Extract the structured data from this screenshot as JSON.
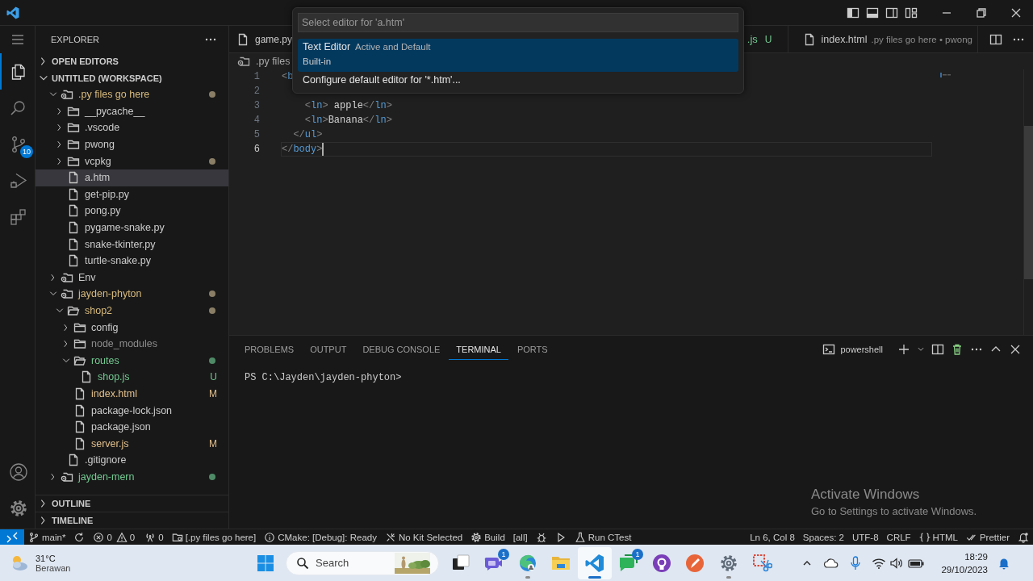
{
  "quick_pick": {
    "placeholder": "Select editor for 'a.htm'",
    "items": [
      {
        "label": "Text Editor",
        "description": "Active and Default",
        "detail": "Built-in",
        "selected": true
      },
      {
        "label": "Configure default editor for '*.htm'...",
        "selected": false
      }
    ]
  },
  "activity_bar": {
    "items": [
      {
        "kind": "explorer",
        "selected": true
      },
      {
        "kind": "search",
        "selected": false
      },
      {
        "kind": "source_control",
        "selected": false,
        "badge": "10"
      },
      {
        "kind": "run",
        "selected": false
      },
      {
        "kind": "extensions",
        "selected": false
      }
    ],
    "bottom": [
      {
        "kind": "account"
      },
      {
        "kind": "settings"
      }
    ]
  },
  "sidebar": {
    "title": "EXPLORER",
    "sections": [
      {
        "label": "OPEN EDITORS",
        "expanded": false
      },
      {
        "label": "UNTITLED (WORKSPACE)",
        "expanded": true,
        "tree": [
          {
            "label": ".py files go here",
            "kind": "root",
            "expanded": true,
            "selected": false,
            "color": "#d7ba7d",
            "status_dot": {
              "color": "#8a7e66"
            },
            "children": [
              {
                "label": "__pycache__",
                "kind": "folder",
                "expanded": false,
                "selected": false,
                "color": "#cccccc"
              },
              {
                "label": ".vscode",
                "kind": "folder",
                "expanded": false,
                "selected": false,
                "color": "#cccccc"
              },
              {
                "label": "pwong",
                "kind": "folder",
                "expanded": false,
                "selected": false,
                "color": "#cccccc"
              },
              {
                "label": "vcpkg",
                "kind": "folder",
                "expanded": false,
                "selected": false,
                "color": "#cccccc",
                "status_dot": {
                  "color": "#8a7e66"
                }
              },
              {
                "label": "a.htm",
                "kind": "file",
                "selected": true,
                "color": "#cccccc"
              },
              {
                "label": "get-pip.py",
                "kind": "file",
                "selected": false,
                "color": "#cccccc"
              },
              {
                "label": "pong.py",
                "kind": "file",
                "selected": false,
                "color": "#cccccc"
              },
              {
                "label": "pygame-snake.py",
                "kind": "file",
                "selected": false,
                "color": "#cccccc"
              },
              {
                "label": "snake-tkinter.py",
                "kind": "file",
                "selected": false,
                "color": "#cccccc"
              },
              {
                "label": "turtle-snake.py",
                "kind": "file",
                "selected": false,
                "color": "#cccccc"
              }
            ]
          },
          {
            "label": "Env",
            "kind": "root",
            "expanded": false,
            "selected": false,
            "color": "#cccccc"
          },
          {
            "label": "jayden-phyton",
            "kind": "root",
            "expanded": true,
            "selected": false,
            "color": "#d7ba7d",
            "status_dot": {
              "color": "#8a7e66"
            },
            "children": [
              {
                "label": "shop2",
                "kind": "folder",
                "expanded": true,
                "selected": false,
                "color": "#d7ba7d",
                "status_dot": {
                  "color": "#8a7e66"
                },
                "children": [
                  {
                    "label": "config",
                    "kind": "folder",
                    "expanded": false,
                    "selected": false,
                    "color": "#cccccc"
                  },
                  {
                    "label": "node_modules",
                    "kind": "folder",
                    "expanded": false,
                    "selected": false,
                    "color": "#8c8c8c"
                  },
                  {
                    "label": "routes",
                    "kind": "folder",
                    "expanded": true,
                    "selected": false,
                    "color": "#73c991",
                    "status_dot": {
                      "color": "#4e8a66"
                    },
                    "children": [
                      {
                        "label": "shop.js",
                        "kind": "file",
                        "selected": false,
                        "color": "#73c991",
                        "badge": "U"
                      }
                    ]
                  },
                  {
                    "label": "index.html",
                    "kind": "file",
                    "selected": false,
                    "color": "#e2c08d",
                    "badge": "M"
                  },
                  {
                    "label": "package-lock.json",
                    "kind": "file",
                    "selected": false,
                    "color": "#cccccc"
                  },
                  {
                    "label": "package.json",
                    "kind": "file",
                    "selected": false,
                    "color": "#cccccc"
                  },
                  {
                    "label": "server.js",
                    "kind": "file",
                    "selected": false,
                    "color": "#e2c08d",
                    "badge": "M"
                  }
                ]
              },
              {
                "label": ".gitignore",
                "kind": "file",
                "selected": false,
                "color": "#cccccc"
              }
            ]
          },
          {
            "label": "jayden-mern",
            "kind": "root",
            "expanded": false,
            "selected": false,
            "color": "#73c991",
            "status_dot": {
              "color": "#4e8a66"
            }
          }
        ]
      }
    ],
    "bottom_sections": [
      {
        "label": "OUTLINE",
        "expanded": false
      },
      {
        "label": "TIMELINE",
        "expanded": false
      }
    ]
  },
  "editor": {
    "tabs": [
      {
        "label": "game.py",
        "color": "#cccccc"
      },
      {
        "label": ".js",
        "color": "#73c991",
        "badge": "U"
      },
      {
        "label": "index.html",
        "color": "#c5c5c5",
        "description": ".py files go here • pwong"
      }
    ],
    "breadcrumb": ".py files",
    "lines": [
      {
        "number": "1",
        "selected": false,
        "tokens": [
          {
            "kind": "punct",
            "text": "<"
          },
          {
            "kind": "tag",
            "text": "b"
          }
        ]
      },
      {
        "number": "2",
        "selected": false
      },
      {
        "number": "3",
        "selected": false,
        "tokens": [
          {
            "kind": "punct",
            "text": "    <"
          },
          {
            "kind": "tag",
            "text": "ln"
          },
          {
            "kind": "punct",
            "text": ">"
          },
          {
            "kind": "text",
            "text": " apple"
          },
          {
            "kind": "punct",
            "text": "</"
          },
          {
            "kind": "tag",
            "text": "ln"
          },
          {
            "kind": "punct",
            "text": ">"
          }
        ]
      },
      {
        "number": "4",
        "selected": false,
        "tokens": [
          {
            "kind": "punct",
            "text": "    <"
          },
          {
            "kind": "tag",
            "text": "ln"
          },
          {
            "kind": "punct",
            "text": ">"
          },
          {
            "kind": "text",
            "text": "Banana"
          },
          {
            "kind": "punct",
            "text": "</"
          },
          {
            "kind": "tag",
            "text": "ln"
          },
          {
            "kind": "punct",
            "text": ">"
          }
        ]
      },
      {
        "number": "5",
        "selected": false,
        "tokens": [
          {
            "kind": "punct",
            "text": "  </"
          },
          {
            "kind": "tag",
            "text": "ul"
          },
          {
            "kind": "punct",
            "text": ">"
          }
        ]
      },
      {
        "number": "6",
        "selected": true,
        "tokens": [
          {
            "kind": "punct",
            "text": "</"
          },
          {
            "kind": "tag",
            "text": "body"
          },
          {
            "kind": "punct",
            "text": ">"
          }
        ]
      }
    ]
  },
  "panel": {
    "tabs": [
      {
        "label": "PROBLEMS",
        "selected": false
      },
      {
        "label": "OUTPUT",
        "selected": false
      },
      {
        "label": "DEBUG CONSOLE",
        "selected": false
      },
      {
        "label": "TERMINAL",
        "selected": true
      },
      {
        "label": "PORTS",
        "selected": false
      }
    ],
    "terminal_name": "powershell",
    "terminal_lines": [
      "PS C:\\Jayden\\jayden-phyton>"
    ]
  },
  "activation_notice": {
    "title": "Activate Windows",
    "subtitle": "Go to Settings to activate Windows."
  },
  "status_bar": {
    "left": [
      {
        "kind": "remote"
      },
      {
        "kind": "branch",
        "text": "main*"
      },
      {
        "kind": "sync"
      },
      {
        "kind": "errors",
        "text": "0"
      },
      {
        "kind": "warnings",
        "text": "0"
      },
      {
        "kind": "ports",
        "text": "0"
      },
      {
        "kind": "folder",
        "text": "[.py files go here]"
      },
      {
        "kind": "info",
        "text": "CMake: [Debug]: Ready"
      },
      {
        "kind": "kit",
        "text": "No Kit Selected"
      },
      {
        "kind": "build",
        "text": "Build"
      },
      {
        "kind": "plain",
        "text": "[all]"
      },
      {
        "kind": "debug"
      },
      {
        "kind": "play"
      },
      {
        "kind": "test",
        "text": "Run CTest"
      }
    ],
    "right": [
      {
        "kind": "plain",
        "text": "Ln 6, Col 8"
      },
      {
        "kind": "plain",
        "text": "Spaces: 2"
      },
      {
        "kind": "plain",
        "text": "UTF-8"
      },
      {
        "kind": "plain",
        "text": "CRLF"
      },
      {
        "kind": "language",
        "text": "HTML"
      },
      {
        "kind": "prettier",
        "text": "Prettier"
      },
      {
        "kind": "bell"
      }
    ]
  },
  "taskbar": {
    "weather": {
      "temperature": "31°C",
      "condition": "Berawan"
    },
    "search": {
      "placeholder": "Search"
    },
    "apps": [
      {
        "kind": "taskview",
        "selected": false,
        "running": false
      },
      {
        "kind": "meet",
        "selected": false,
        "running": false,
        "badge": "1"
      },
      {
        "kind": "edge",
        "selected": false,
        "running": true
      },
      {
        "kind": "files",
        "selected": false,
        "running": false
      },
      {
        "kind": "vscode",
        "selected": true,
        "running": true
      },
      {
        "kind": "chat",
        "selected": false,
        "running": false,
        "badge": "1"
      },
      {
        "kind": "github",
        "selected": false,
        "running": false
      },
      {
        "kind": "pen",
        "selected": false,
        "running": false
      },
      {
        "kind": "settings",
        "selected": false,
        "running": true
      },
      {
        "kind": "snip",
        "selected": false,
        "running": false
      }
    ],
    "clock": {
      "time": "18:29",
      "date": "29/10/2023"
    }
  }
}
